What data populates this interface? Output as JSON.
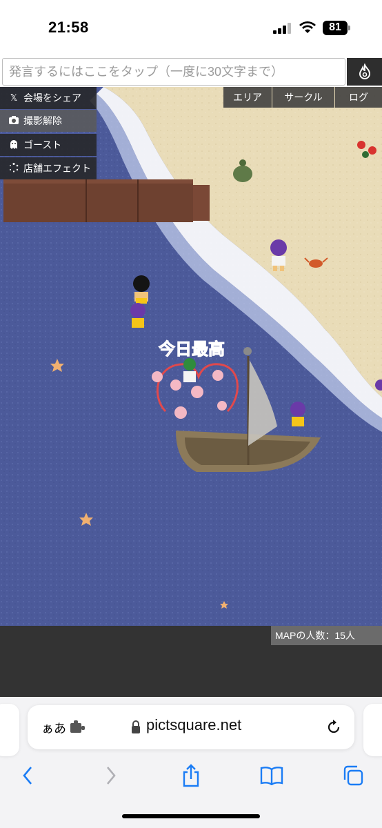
{
  "status_bar": {
    "time": "21:58",
    "battery_level": "81",
    "icons": [
      "signal-icon",
      "wifi-icon",
      "battery-icon"
    ]
  },
  "chat": {
    "placeholder": "発言するにはここをタップ（一度に30文字まで）",
    "flame_icon": "flame-icon"
  },
  "side_menu": {
    "share_label": "会場をシェア",
    "photo_label": "撮影解除",
    "ghost_label": "ゴースト",
    "effect_label": "店舗エフェクト"
  },
  "tabs": {
    "area": "エリア",
    "circle": "サークル",
    "log": "ログ"
  },
  "map": {
    "speech_bubble": "今日最高",
    "people_count": "MAPの人数：15人"
  },
  "browser": {
    "aa_label": "ぁあ",
    "url": "pictsquare.net"
  },
  "colors": {
    "sea": "#4c5a9a",
    "sand": "#e9dcb8",
    "accent_red": "#e0494d"
  }
}
